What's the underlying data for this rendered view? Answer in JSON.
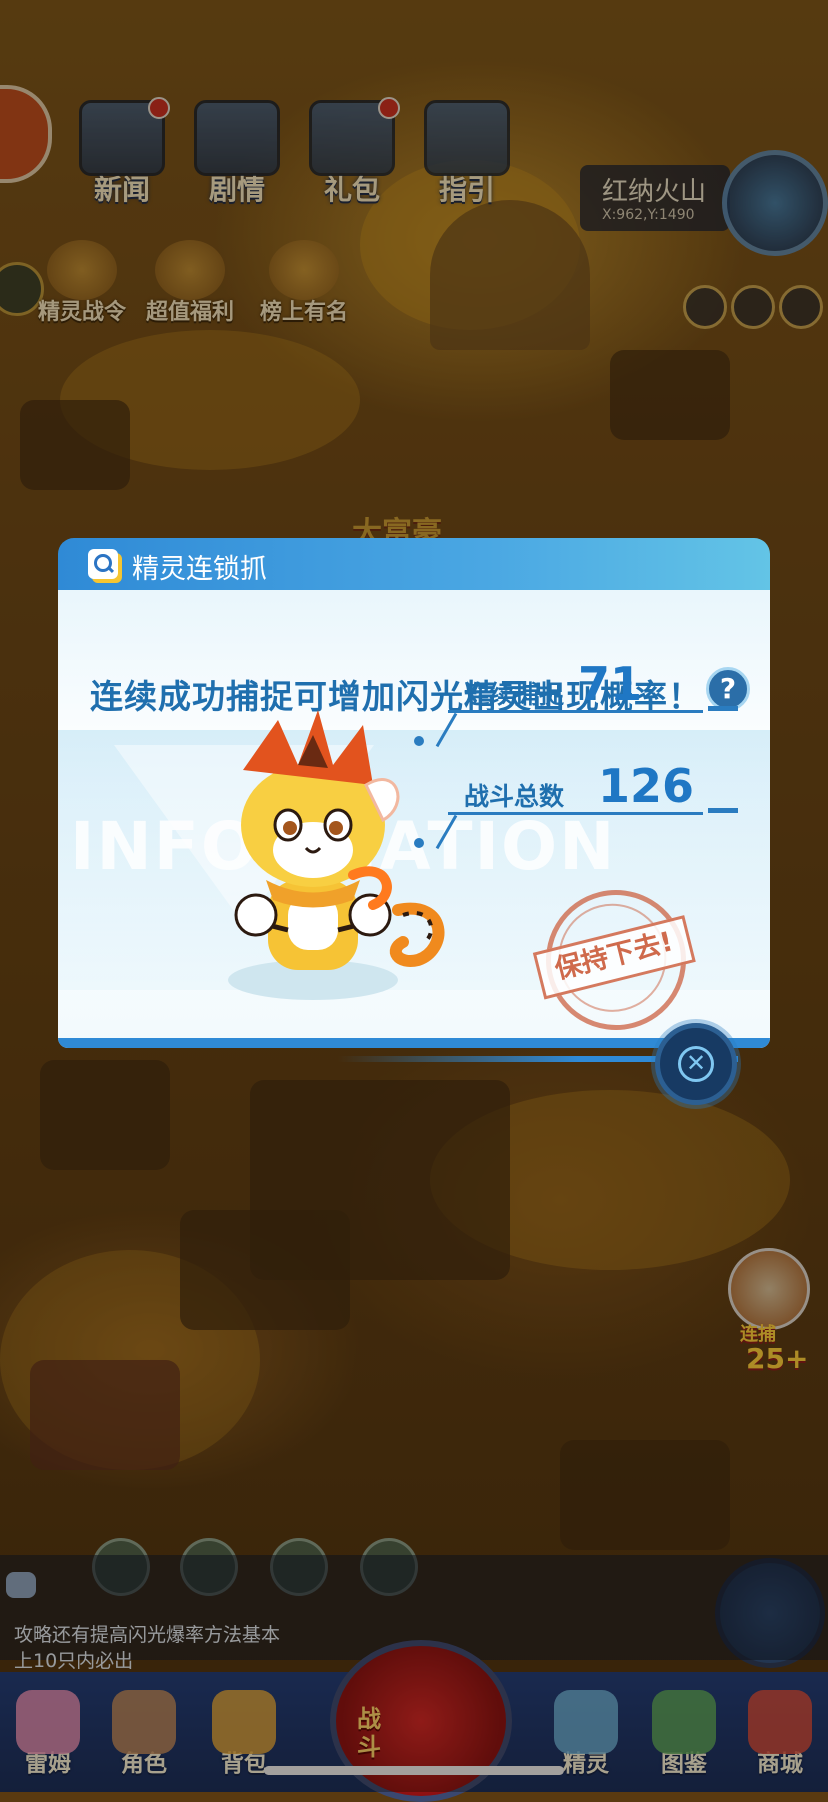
{
  "hud": {
    "top_buttons": [
      {
        "label": "新闻",
        "icon": "news-icon"
      },
      {
        "label": "剧情",
        "icon": "story-icon"
      },
      {
        "label": "礼包",
        "icon": "gift-pack-icon"
      },
      {
        "label": "指引",
        "icon": "guide-icon"
      }
    ],
    "sub_buttons": [
      {
        "label": "精灵战令",
        "icon": "pass-icon"
      },
      {
        "label": "超值福利",
        "icon": "welfare-icon"
      },
      {
        "label": "榜上有名",
        "icon": "ranking-trophy-icon"
      }
    ],
    "location": {
      "name": "红纳火山",
      "coords": "X:962,Y:1490"
    },
    "map_label": "大富豪"
  },
  "modal": {
    "title": "精灵连锁抓",
    "subtitle": "连续成功捕捉可增加闪光精灵出现概率！",
    "help_symbol": "?",
    "watermark": "INFORMATION",
    "stats": [
      {
        "label": "连续捕捉",
        "value": "71"
      },
      {
        "label": "战斗总数",
        "value": "126"
      }
    ],
    "stamp_text": "保持下去!",
    "close_symbol": "✕"
  },
  "side": {
    "streak_tag": "连捕",
    "streak_num": "25+"
  },
  "chat": {
    "lines": [
      "攻略还有提高闪光爆率方法基本",
      "上10只内必出"
    ]
  },
  "bottom_nav": {
    "items": [
      {
        "label": "雷姆",
        "icon": "character-pink-icon"
      },
      {
        "label": "角色",
        "icon": "character-icon"
      },
      {
        "label": "背包",
        "icon": "backpack-icon"
      },
      {
        "label": "精灵",
        "icon": "spirit-icon"
      },
      {
        "label": "图鉴",
        "icon": "codex-icon"
      },
      {
        "label": "商城",
        "icon": "shop-icon"
      }
    ],
    "battle_label": "战斗"
  },
  "colors": {
    "accent_blue": "#2f8ad6",
    "text_blue": "#1f6fae",
    "stamp_red": "#cc6242"
  }
}
